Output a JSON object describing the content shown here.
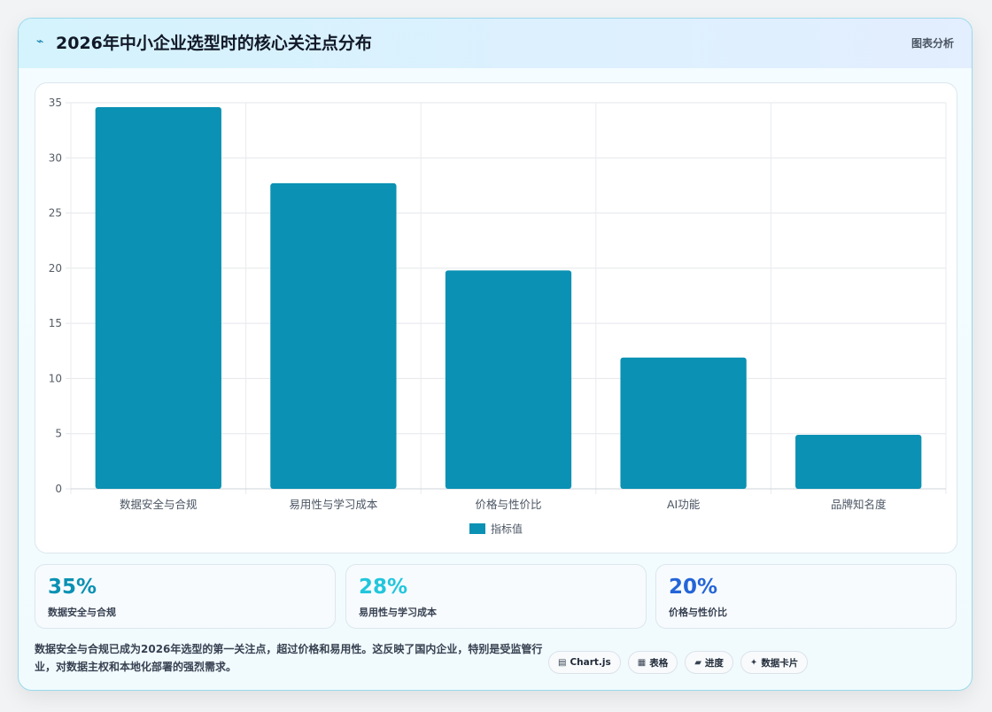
{
  "header": {
    "title": "2026年中小企业选型时的核心关注点分布",
    "tag": "图表分析",
    "icon": "chart-icon"
  },
  "chart_data": {
    "type": "bar",
    "categories": [
      "数据安全与合规",
      "易用性与学习成本",
      "价格与性价比",
      "AI功能",
      "品牌知名度"
    ],
    "series": [
      {
        "name": "指标值",
        "values": [
          34.6,
          27.7,
          19.8,
          11.9,
          4.9
        ],
        "color": "#0a91b3"
      }
    ],
    "ylim": [
      0,
      35
    ],
    "yticks": [
      0,
      5,
      10,
      15,
      20,
      25,
      30,
      35
    ],
    "grid": true,
    "legend": "bottom"
  },
  "stats": [
    {
      "value": "35%",
      "label": "数据安全与合规",
      "color": "#0a91b3"
    },
    {
      "value": "28%",
      "label": "易用性与学习成本",
      "color": "#22c6dc"
    },
    {
      "value": "20%",
      "label": "价格与性价比",
      "color": "#2565d8"
    }
  ],
  "footer": {
    "text": "数据安全与合规已成为2026年选型的第一关注点，超过价格和易用性。这反映了国内企业，特别是受监管行业，对数据主权和本地化部署的强烈需求。"
  },
  "chips": [
    {
      "icon": "▤",
      "icon_name": "chart-icon",
      "label": "Chart.js"
    },
    {
      "icon": "▦",
      "icon_name": "table-icon",
      "label": "表格"
    },
    {
      "icon": "▰",
      "icon_name": "progress-icon",
      "label": "进度"
    },
    {
      "icon": "✦",
      "icon_name": "sparkle-icon",
      "label": "数据卡片"
    }
  ]
}
